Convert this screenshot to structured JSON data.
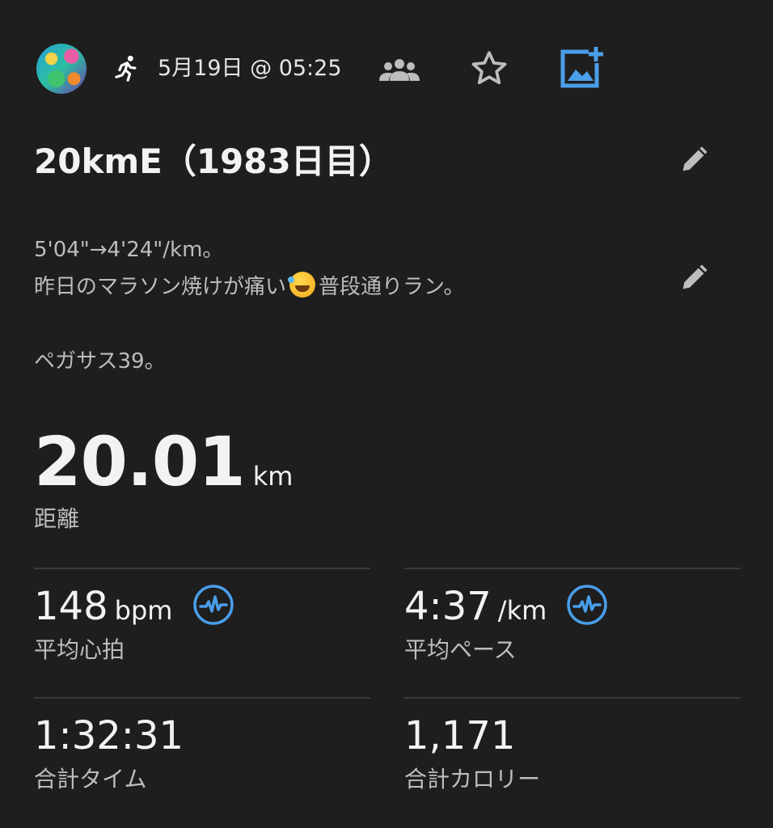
{
  "header": {
    "date_time": "5月19日 @ 05:25",
    "activity_icon": "running-icon",
    "group_icon": "group-icon",
    "favorite_icon": "star-icon",
    "add_photo_icon": "add-photo-icon"
  },
  "activity": {
    "title": "20kmE（1983日目）",
    "description_line1": "5'04\"→4'24\"/km。",
    "description_line2_a": "昨日のマラソン焼けが痛い",
    "description_line2_b": "普段通りラン。",
    "description_line3": "ペガサス39。"
  },
  "stats": {
    "distance_value": "20.01",
    "distance_unit": "km",
    "distance_label": "距離",
    "avg_hr_value": "148",
    "avg_hr_unit": "bpm",
    "avg_hr_label": "平均心拍",
    "avg_pace_value": "4:37",
    "avg_pace_unit": "/km",
    "avg_pace_label": "平均ペース",
    "total_time_value": "1:32:31",
    "total_time_label": "合計タイム",
    "calories_value": "1,171",
    "calories_label": "合計カロリー"
  },
  "colors": {
    "background": "#1e1e1e",
    "accent": "#4a9eea",
    "icon_gray": "#bdbdbd"
  }
}
